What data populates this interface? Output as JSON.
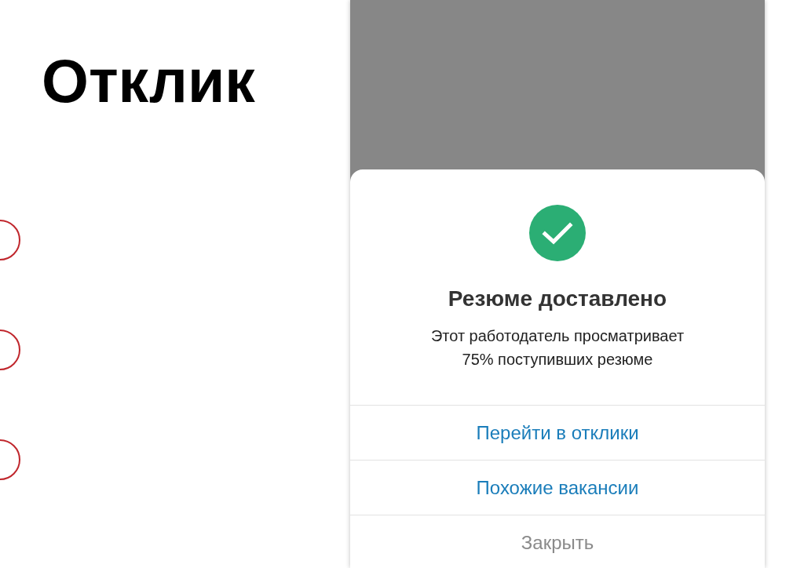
{
  "page": {
    "title": "Отклик"
  },
  "dialog": {
    "title": "Резюме доставлено",
    "message": "Этот работодатель просматривает 75% поступивших резюме",
    "actions": [
      {
        "label": "Перейти в отклики",
        "kind": "primary"
      },
      {
        "label": "Похожие вакансии",
        "kind": "primary"
      },
      {
        "label": "Закрыть",
        "kind": "secondary"
      }
    ]
  }
}
